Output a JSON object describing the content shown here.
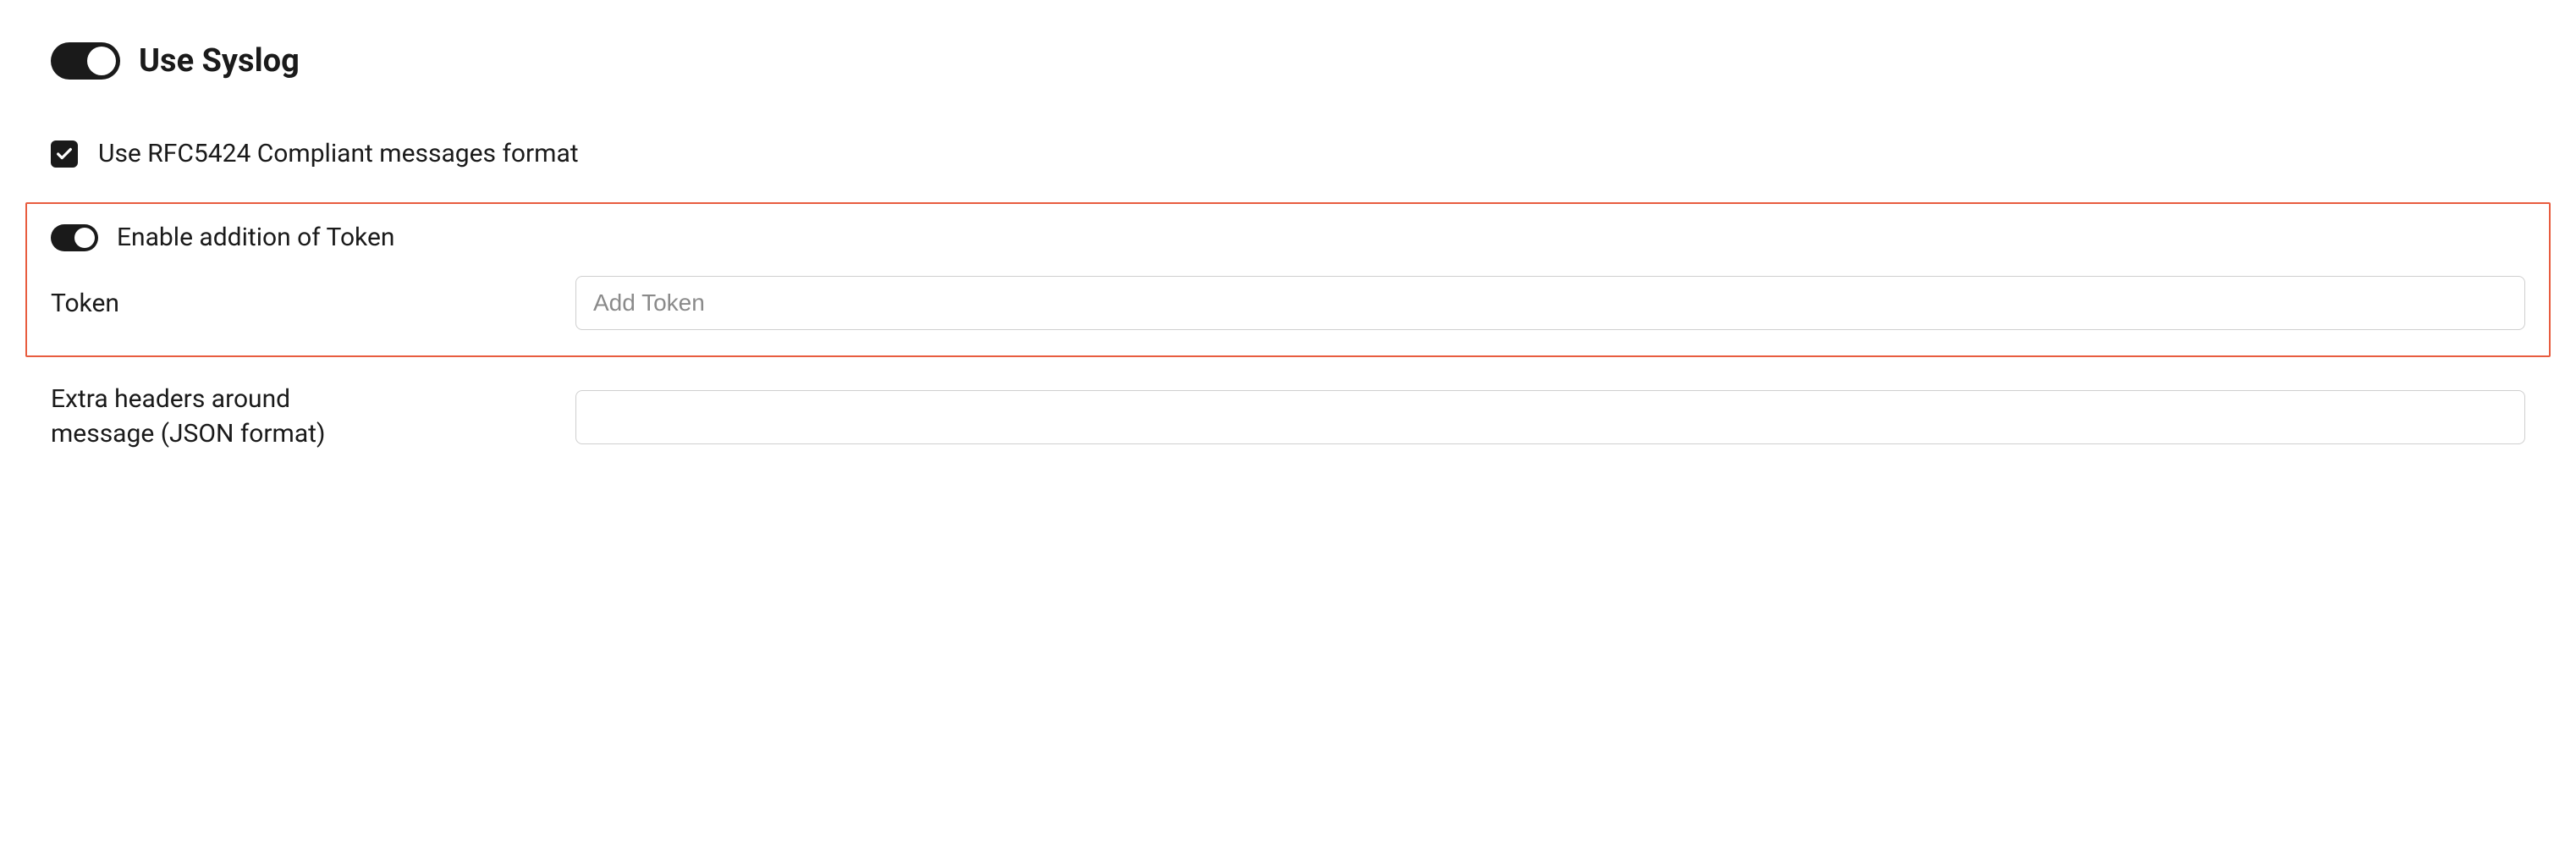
{
  "syslog": {
    "toggle_on": true,
    "label": "Use Syslog"
  },
  "rfc5424": {
    "checked": true,
    "label": "Use RFC5424 Compliant messages format"
  },
  "token_section": {
    "enable_toggle_on": true,
    "enable_label": "Enable addition of Token",
    "field_label": "Token",
    "placeholder": "Add Token",
    "value": ""
  },
  "extra_headers": {
    "label_line1": "Extra headers around",
    "label_line2": " message (JSON format)",
    "value": ""
  }
}
